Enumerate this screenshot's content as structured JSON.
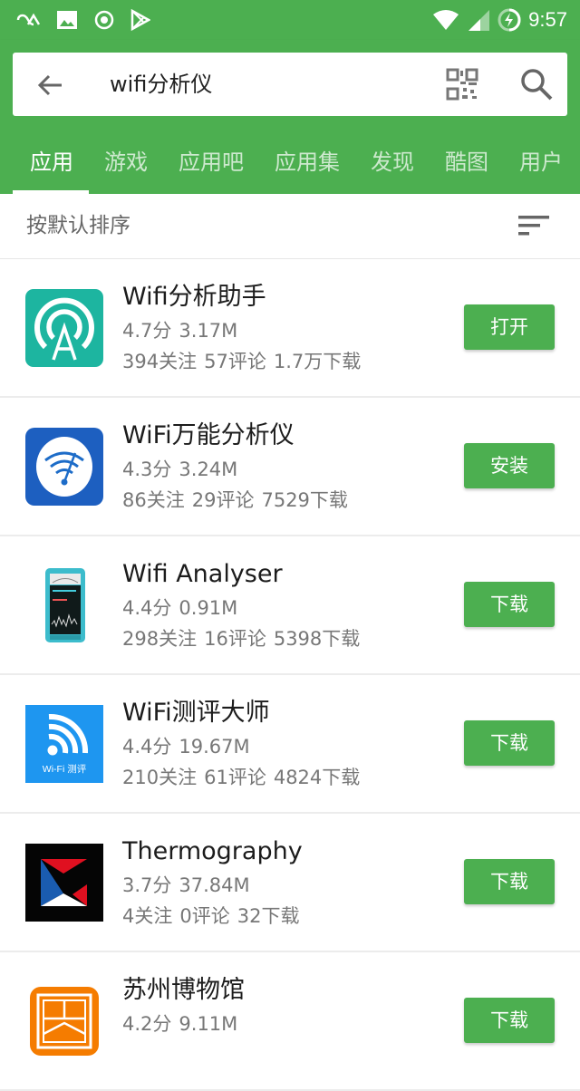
{
  "status_bar": {
    "left_icons": [
      "infinity-icon",
      "image-icon",
      "record-icon",
      "play-store-icon"
    ],
    "right_icons": [
      "wifi-icon",
      "signal-icon",
      "battery-charging-icon"
    ],
    "time": "9:57"
  },
  "search": {
    "query": "wifi分析仪",
    "back_icon": "arrow-back-icon",
    "qr_icon": "qr-code-icon",
    "search_icon": "search-icon"
  },
  "tabs": [
    {
      "label": "应用",
      "active": true
    },
    {
      "label": "游戏",
      "active": false
    },
    {
      "label": "应用吧",
      "active": false
    },
    {
      "label": "应用集",
      "active": false
    },
    {
      "label": "发现",
      "active": false
    },
    {
      "label": "酷图",
      "active": false
    },
    {
      "label": "用户",
      "active": false
    }
  ],
  "sort": {
    "label": "按默认排序",
    "icon": "sort-icon"
  },
  "apps": [
    {
      "name": "Wifi分析助手",
      "rating": "4.7分",
      "size": "3.17M",
      "follows": "394关注",
      "comments": "57评论",
      "downloads": "1.7万下载",
      "action": "打开",
      "icon": "wifi-assistant-icon"
    },
    {
      "name": "WiFi万能分析仪",
      "rating": "4.3分",
      "size": "3.24M",
      "follows": "86关注",
      "comments": "29评论",
      "downloads": "7529下载",
      "action": "安装",
      "icon": "wifi-analyzer-icon"
    },
    {
      "name": "Wifi Analyser",
      "rating": "4.4分",
      "size": "0.91M",
      "follows": "298关注",
      "comments": "16评论",
      "downloads": "5398下载",
      "action": "下载",
      "icon": "meter-device-icon"
    },
    {
      "name": "WiFi测评大师",
      "rating": "4.4分",
      "size": "19.67M",
      "follows": "210关注",
      "comments": "61评论",
      "downloads": "4824下载",
      "action": "下载",
      "icon": "wifi-test-icon",
      "icon_caption": "Wi-Fi 测评"
    },
    {
      "name": "Thermography",
      "rating": "3.7分",
      "size": "37.84M",
      "follows": "4关注",
      "comments": "0评论",
      "downloads": "32下载",
      "action": "下载",
      "icon": "thermography-icon"
    },
    {
      "name": "苏州博物馆",
      "rating": "4.2分",
      "size": "9.11M",
      "follows": "",
      "comments": "",
      "downloads": "",
      "action": "下载",
      "icon": "museum-icon"
    }
  ],
  "colors": {
    "primary": "#4caf50",
    "teal_icon": "#1db5a0",
    "blue_icon": "#1d5fc0",
    "sky_icon": "#1e96f0",
    "orange_icon": "#f57c00"
  }
}
